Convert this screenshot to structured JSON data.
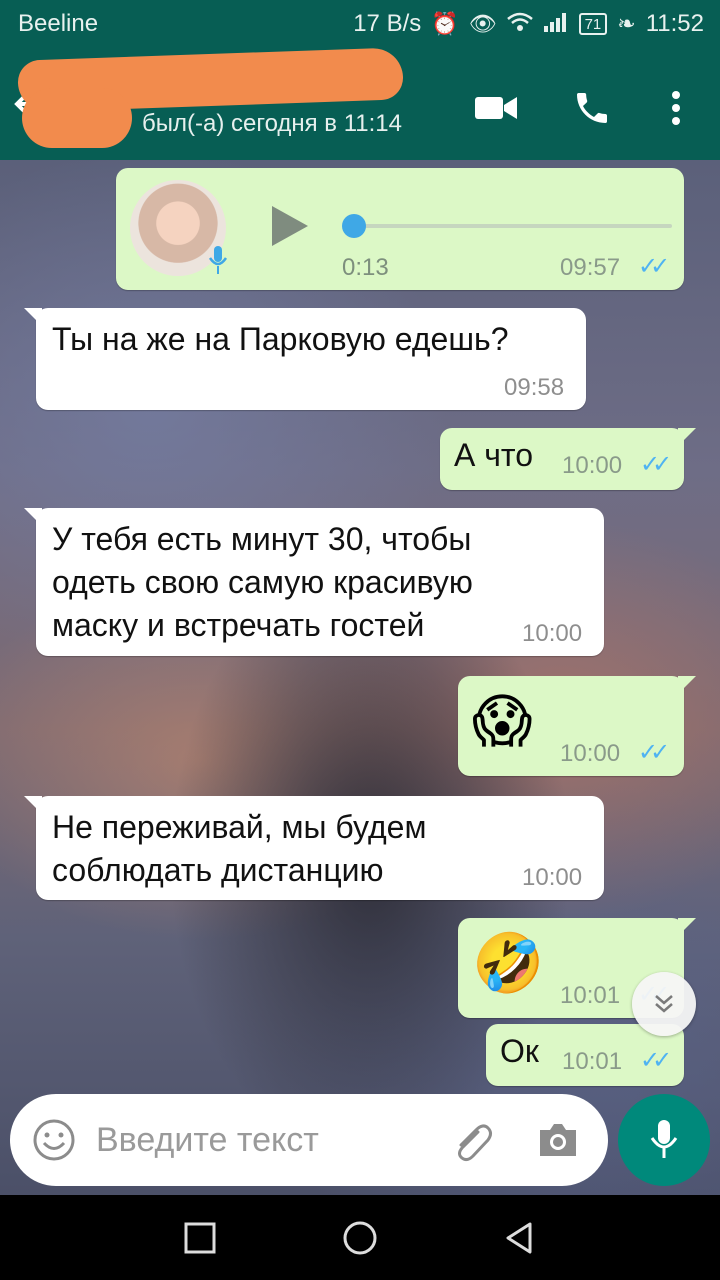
{
  "status_bar": {
    "carrier": "Beeline",
    "speed": "17 B/s",
    "battery": "71",
    "time": "11:52"
  },
  "header": {
    "last_seen": "был(-а) сегодня в 11:14",
    "icons": [
      "back-arrow-icon",
      "video-call-icon",
      "phone-icon",
      "more-vertical-icon"
    ]
  },
  "messages": [
    {
      "dir": "out",
      "type": "voice",
      "duration": "0:13",
      "time": "09:57",
      "progress": 0.0
    },
    {
      "dir": "in",
      "text": "Ты на же на Парковую едешь?",
      "time": "09:58"
    },
    {
      "dir": "out",
      "text": "А что",
      "time": "10:00"
    },
    {
      "dir": "in",
      "lines": [
        "У тебя есть минут 30, чтобы",
        "одеть свою самую красивую",
        "маску и встречать гостей"
      ],
      "time": "10:00"
    },
    {
      "dir": "out",
      "emoji": "😱",
      "time": "10:00"
    },
    {
      "dir": "in",
      "lines": [
        "Не переживай, мы будем",
        "соблюдать дистанцию"
      ],
      "time": "10:00"
    },
    {
      "dir": "out",
      "emoji": "🤣",
      "time": "10:01"
    },
    {
      "dir": "out",
      "text": "Ок",
      "time": "10:01"
    }
  ],
  "input": {
    "placeholder": "Введите текст"
  },
  "colors": {
    "header": "#075e54",
    "outgoing": "#dcf8c6",
    "incoming": "#ffffff",
    "ticks": "#4fb3f2",
    "mic": "#00897b"
  }
}
